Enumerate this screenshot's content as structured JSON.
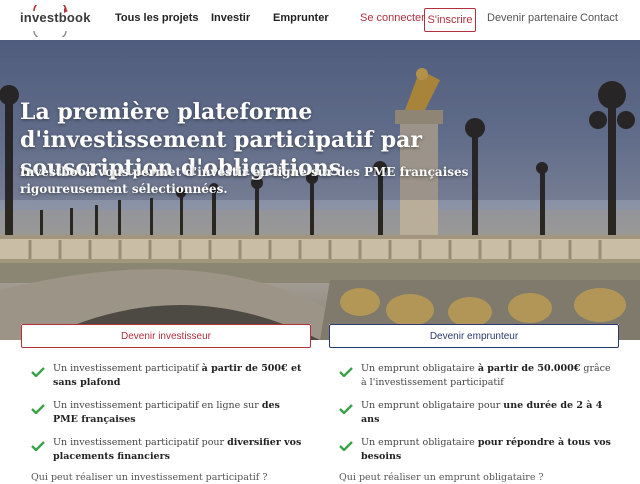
{
  "nav": {
    "logo_text": "investbook",
    "links": [
      "Tous les projets",
      "Investir",
      "Emprunter"
    ],
    "login": "Se connecter",
    "signup": "S'inscrire",
    "partner": "Devenir partenaire",
    "contact": "Contact"
  },
  "hero": {
    "title": "La première plateforme d'investissement participatif par souscription d'obligations",
    "subtitle": "Investbook vous permet d'investir en ligne sur des PME françaises rigoureusement sélectionnées."
  },
  "investor": {
    "button": "Devenir investisseur",
    "features": [
      {
        "pre": "Un investissement participatif ",
        "bold": "à partir de 500€ et sans plafond",
        "post": ""
      },
      {
        "pre": "Un investissement participatif en ligne sur ",
        "bold": "des PME françaises",
        "post": ""
      },
      {
        "pre": "Un investissement participatif pour ",
        "bold": "diversifier vos placements financiers",
        "post": ""
      }
    ],
    "faq": "Qui peut réaliser un investissement participatif ?"
  },
  "borrower": {
    "button": "Devenir emprunteur",
    "features": [
      {
        "pre": "Un emprunt obligataire ",
        "bold": "à partir de 50.000€",
        "post": " grâce à l'investissement participatif"
      },
      {
        "pre": "Un emprunt obligataire pour ",
        "bold": "une durée de 2 à 4 ans",
        "post": ""
      },
      {
        "pre": "Un emprunt obligataire ",
        "bold": "pour répondre à tous vos besoins",
        "post": ""
      }
    ],
    "faq": "Qui peut réaliser un emprunt obligataire ?"
  },
  "colors": {
    "brand_red": "#b0303e",
    "brand_navy": "#2b3a6e",
    "check_green": "#3aa34a"
  }
}
